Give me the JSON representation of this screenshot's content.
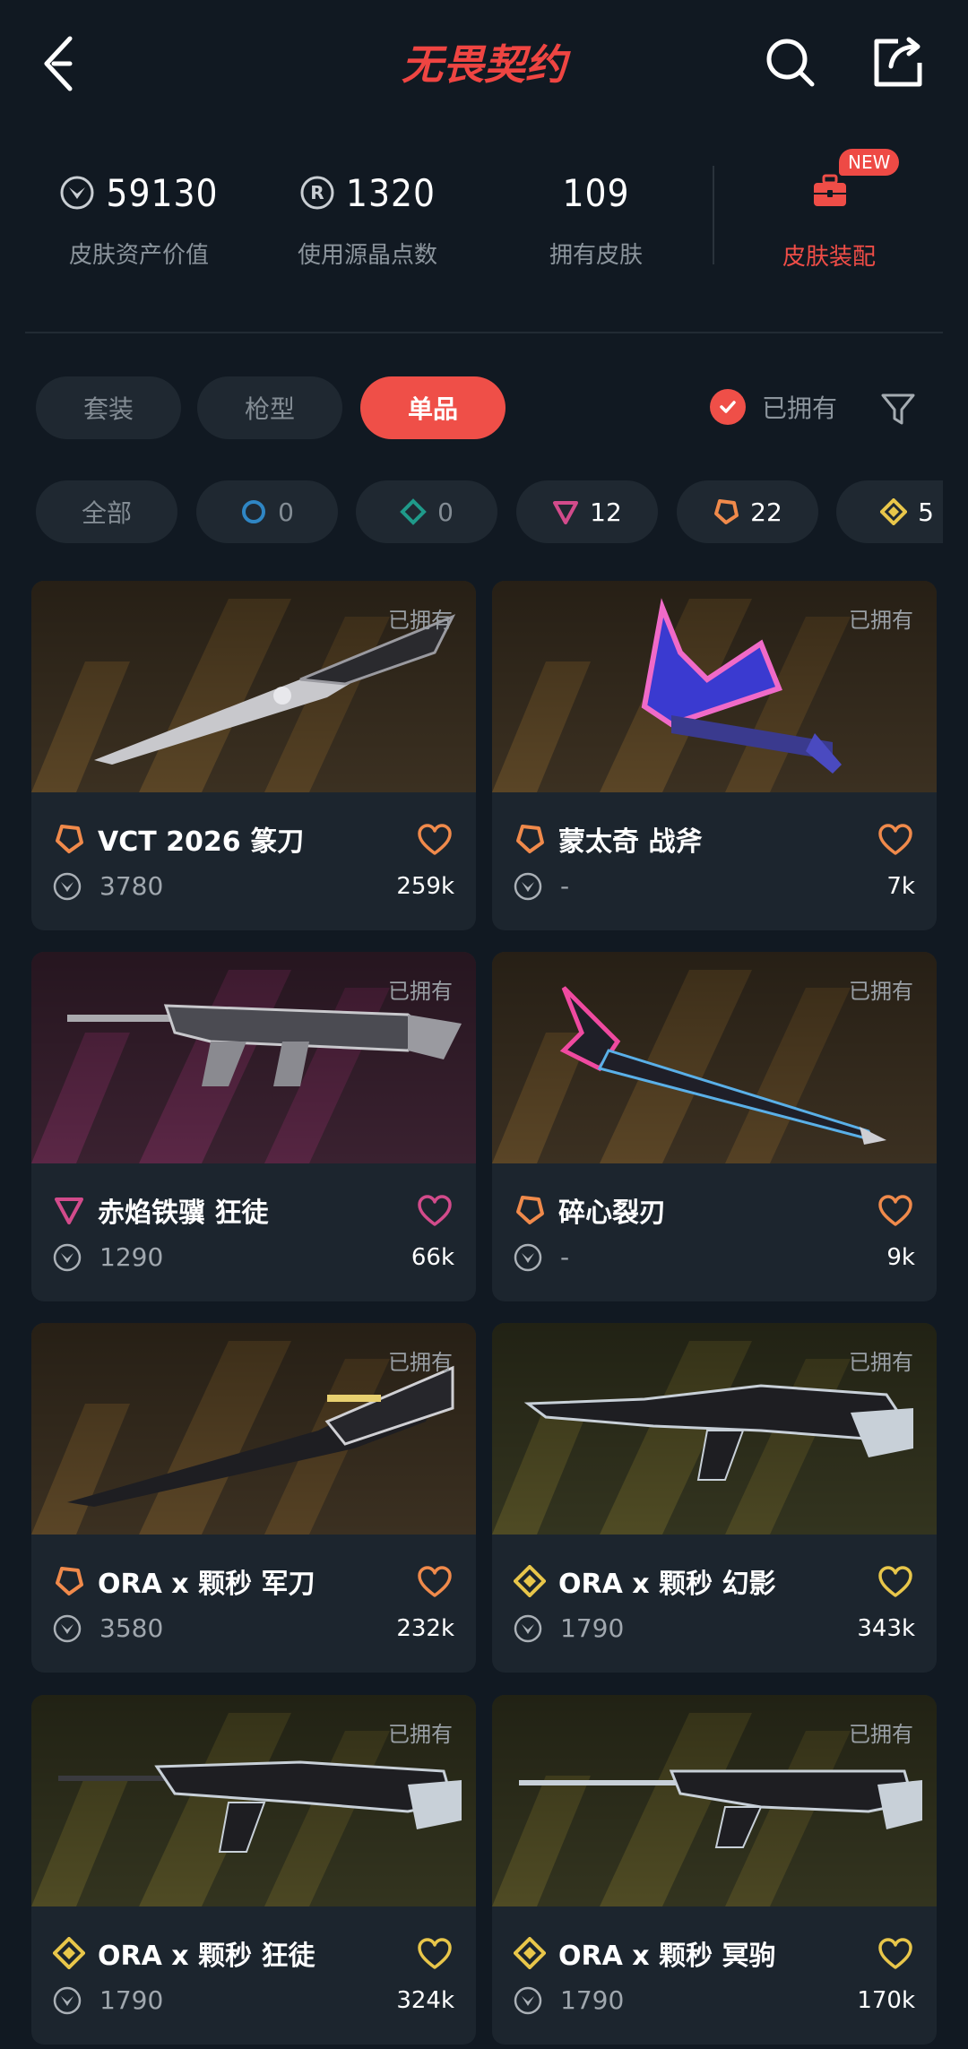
{
  "header": {
    "title": "无畏契约",
    "back_icon": "chevron-left-icon",
    "search_icon": "search-icon",
    "share_icon": "share-icon"
  },
  "stats": {
    "asset_value": "59130",
    "asset_label": "皮肤资产价值",
    "radianite": "1320",
    "radianite_label": "使用源晶点数",
    "owned": "109",
    "owned_label": "拥有皮肤",
    "equip_badge": "NEW",
    "equip_label": "皮肤装配"
  },
  "tabs": {
    "items": [
      "套装",
      "枪型",
      "单品"
    ],
    "active": "单品",
    "owned_toggle": "已拥有",
    "owned_checked": true
  },
  "chips": {
    "all": "全部",
    "tier1": "0",
    "tier2": "0",
    "tier3": "12",
    "tier4": "22",
    "tier5": "5"
  },
  "cards": [
    {
      "name": "VCT 2026 篆刀",
      "price": "3780",
      "likes": "259k",
      "owned": "已拥有",
      "tier": "exclusive",
      "theme": "brown"
    },
    {
      "name": "蒙太奇 战斧",
      "price": "-",
      "likes": "7k",
      "owned": "已拥有",
      "tier": "exclusive",
      "theme": "brown"
    },
    {
      "name": "赤焰铁骥 狂徒",
      "price": "1290",
      "likes": "66k",
      "owned": "已拥有",
      "tier": "premium",
      "theme": "purple"
    },
    {
      "name": "碎心裂刃",
      "price": "-",
      "likes": "9k",
      "owned": "已拥有",
      "tier": "exclusive",
      "theme": "brown"
    },
    {
      "name": "ORA x 颗秒 军刀",
      "price": "3580",
      "likes": "232k",
      "owned": "已拥有",
      "tier": "exclusive",
      "theme": "brown"
    },
    {
      "name": "ORA x 颗秒 幻影",
      "price": "1790",
      "likes": "343k",
      "owned": "已拥有",
      "tier": "ultra",
      "theme": "olive"
    },
    {
      "name": "ORA x 颗秒 狂徒",
      "price": "1790",
      "likes": "324k",
      "owned": "已拥有",
      "tier": "ultra",
      "theme": "olive"
    },
    {
      "name": "ORA x 颗秒 冥驹",
      "price": "1790",
      "likes": "170k",
      "owned": "已拥有",
      "tier": "ultra",
      "theme": "olive"
    }
  ],
  "colors": {
    "accent": "#ef4f48",
    "background": "#111922",
    "card": "#1c252e",
    "tier_exclusive": "#f08a4b",
    "tier_premium": "#d24b8b",
    "tier_ultra": "#e8c64a"
  }
}
